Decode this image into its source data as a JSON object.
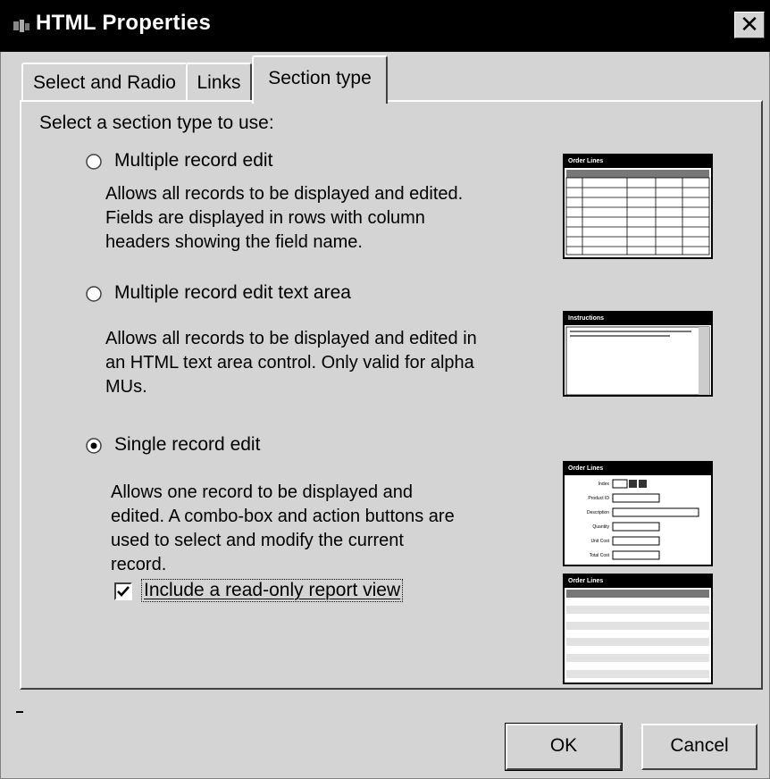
{
  "window": {
    "title": "HTML Properties",
    "close_glyph": "✕"
  },
  "tabs": [
    {
      "label": "Select and Radio",
      "active": false
    },
    {
      "label": "Links",
      "active": false
    },
    {
      "label": "Section type",
      "active": true
    }
  ],
  "prompt": "Select a section type to use:",
  "options": [
    {
      "label": "Multiple record edit",
      "selected": false,
      "description": [
        "Allows all records to be displayed and edited.",
        "Fields are displayed in rows with column",
        "headers showing the field name."
      ]
    },
    {
      "label": "Multiple record edit text area",
      "selected": false,
      "description": [
        "Allows all records to be displayed and edited in",
        "an HTML text area control. Only valid for alpha",
        "MUs."
      ]
    },
    {
      "label": "Single record edit",
      "selected": true,
      "description": [
        "Allows one record to be displayed and",
        "edited. A combo-box and action buttons are",
        "used to select and modify the current",
        "record."
      ]
    }
  ],
  "report_view": {
    "label": "Include a read-only report view",
    "checked": true
  },
  "thumbnails": {
    "multiple": {
      "title": "Order Lines"
    },
    "textarea": {
      "title": "Instructions"
    },
    "single": {
      "title": "Order Lines",
      "fields": [
        "Index",
        "Product ID",
        "Description",
        "Quantity",
        "Unit Cost",
        "Total Cost"
      ]
    },
    "report": {
      "title": "Order Lines"
    }
  },
  "buttons": {
    "ok": "OK",
    "cancel": "Cancel"
  }
}
